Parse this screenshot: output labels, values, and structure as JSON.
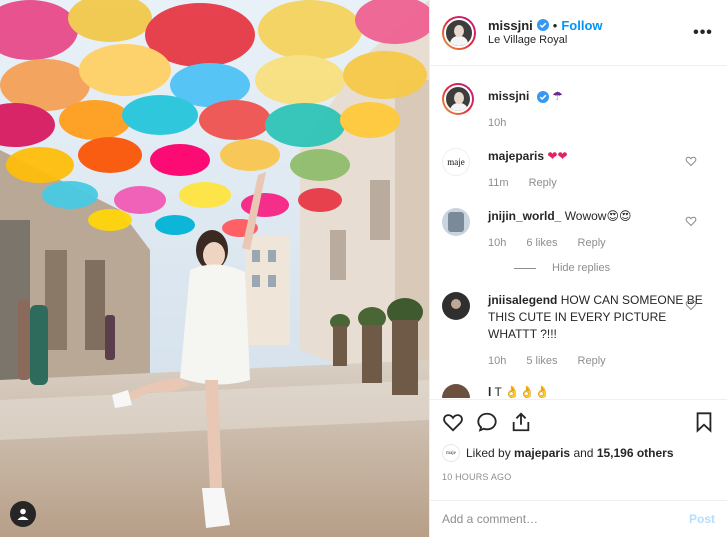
{
  "post": {
    "author": {
      "username": "missjni",
      "follow_label": "Follow",
      "location": "Le Village Royal",
      "avatar_icon": "profile-avatar-icon"
    },
    "more_label": "•••",
    "caption": {
      "username": "missjni",
      "emoji": "☂",
      "time": "10h"
    },
    "comments": [
      {
        "username": "majeparis",
        "text": "❤❤",
        "time": "11m",
        "likes": "",
        "reply_label": "Reply",
        "avatar": "maje"
      },
      {
        "username": "jnijin_world_",
        "text": "Wowow😍😍",
        "time": "10h",
        "likes": "6 likes",
        "reply_label": "Reply",
        "avatar": "photo"
      },
      {
        "username": "jniisalegend",
        "text": "HOW CAN SOMEONE BE THIS CUTE IN EVERY PICTURE WHATTT ?!!!",
        "time": "10h",
        "likes": "5 likes",
        "reply_label": "Reply",
        "avatar": "dark"
      },
      {
        "username": "l",
        "text": "T 👌👌👌",
        "time": "",
        "likes": "",
        "reply_label": "",
        "avatar": "partial"
      }
    ],
    "hide_replies_label": "Hide replies",
    "liked_by": {
      "prefix": "Liked by",
      "user": "majeparis",
      "middle": "and",
      "others": "15,196 others"
    },
    "timestamp": "10 HOURS AGO",
    "add_comment_placeholder": "Add a comment…",
    "post_label": "Post",
    "colors": {
      "link_blue": "#0095f6",
      "heart_red": "#ed4956",
      "muted": "#8e8e8e",
      "post_disabled": "#b2dffc"
    }
  }
}
